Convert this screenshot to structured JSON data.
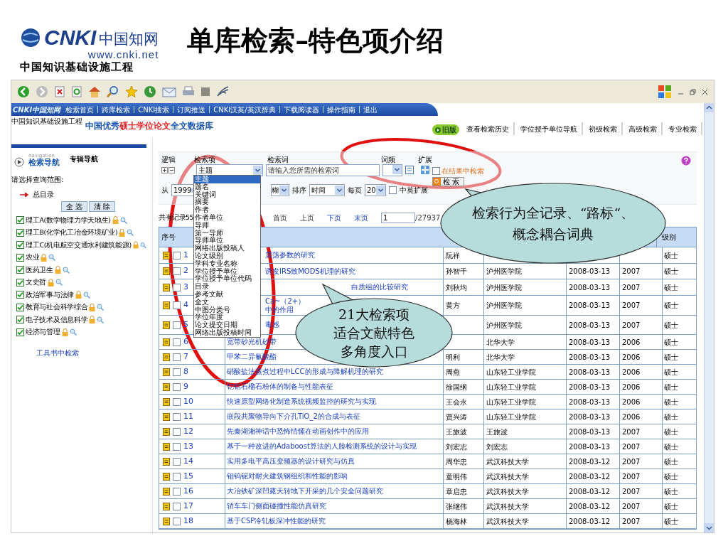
{
  "slide": {
    "title": "单库检索–特色项介绍",
    "logo": {
      "mark": "CNKI",
      "name": "中国知网",
      "url": "www.cnki.net",
      "tagline": "中国知识基础设施工程"
    }
  },
  "site": {
    "logo": "CNKI中国知网",
    "tagline": "中国知识基础设施工程",
    "nav": [
      "检索首页",
      "跨库检索",
      "CNKI搜索",
      "订阅推送",
      "CNKI汉英/英汉辞典",
      "下载阅读器",
      "操作指南",
      "退出"
    ],
    "database": {
      "prefix": "中国优秀",
      "highlight": "硕士学位论文",
      "suffix": "全文数据库"
    },
    "tabs": [
      {
        "label": "旧版",
        "kind": "badge",
        "selected": false
      },
      {
        "label": "查看检索历史",
        "kind": "tab",
        "selected": false
      },
      {
        "label": "学位授予单位导航",
        "kind": "tab",
        "selected": false
      },
      {
        "label": "初级检索",
        "kind": "tab",
        "selected": false
      },
      {
        "label": "高级检索",
        "kind": "tab",
        "selected": false
      },
      {
        "label": "专业检索",
        "kind": "tab",
        "selected": false
      }
    ]
  },
  "sidebar": {
    "nav_caption": "navigation",
    "nav_title": "检索导航",
    "alt_title": "专辑导航",
    "scope_label": "请选择查询范围:",
    "root": "总目录",
    "buttons": [
      "全 选",
      "清 除"
    ],
    "categories": [
      {
        "label": "理工A(数学物理力学天地生)",
        "checked": true
      },
      {
        "label": "理工B(化学化工冶金环境矿业)",
        "checked": true
      },
      {
        "label": "理工C(机电航空交通水利建筑能源)",
        "checked": true
      },
      {
        "label": "农业",
        "checked": true
      },
      {
        "label": "医药卫生",
        "checked": true
      },
      {
        "label": "文史哲",
        "checked": true
      },
      {
        "label": "政治军事与法律",
        "checked": true
      },
      {
        "label": "教育与社会科学综合",
        "checked": true
      },
      {
        "label": "电子技术及信息科学",
        "checked": true
      },
      {
        "label": "经济与管理",
        "checked": true
      }
    ],
    "link": "工具书中检索"
  },
  "search": {
    "headers": [
      "逻辑",
      "检索项",
      "检索词",
      "词频",
      "扩展"
    ],
    "field": "主题",
    "placeholder": "请输入您所需的检索词",
    "in_results": {
      "label": "在结果中检索",
      "checked": false
    },
    "button": "检 索",
    "from_label": "从",
    "from_value": "1999",
    "match_value": "糊",
    "sort_label": "排序",
    "sort_value": "时间",
    "per_page_label": "每页",
    "per_page_value": "20",
    "expand": {
      "label": "中英扩展",
      "checked": false
    }
  },
  "dropdown": {
    "options": [
      {
        "label": "主题",
        "selected": true
      },
      {
        "label": "题名",
        "selected": false
      },
      {
        "label": "关键词",
        "selected": false
      },
      {
        "label": "摘要",
        "selected": false
      },
      {
        "label": "作者",
        "selected": false
      },
      {
        "label": "作者单位",
        "selected": false
      },
      {
        "label": "导师",
        "selected": false
      },
      {
        "label": "第一导师",
        "selected": false
      },
      {
        "label": "导师单位",
        "selected": false
      },
      {
        "label": "网络出版投稿人",
        "selected": false
      },
      {
        "label": "论文级别",
        "selected": false
      },
      {
        "label": "学科专业名称",
        "selected": false
      },
      {
        "label": "学位授予单位",
        "selected": false
      },
      {
        "label": "学位授予单位代码",
        "selected": false
      },
      {
        "label": "目录",
        "selected": false
      },
      {
        "label": "参考文献",
        "selected": false
      },
      {
        "label": "全文",
        "selected": false
      },
      {
        "label": "中图分类号",
        "selected": false
      },
      {
        "label": "学位年度",
        "selected": false
      },
      {
        "label": "论文提交日期",
        "selected": false
      },
      {
        "label": "网络出版投稿时间",
        "selected": false
      }
    ]
  },
  "pager": {
    "count": "共有记录55",
    "links": [
      "首页",
      "上页",
      "下页",
      "末页"
    ],
    "page": "1",
    "total": "/27937"
  },
  "table": {
    "columns": [
      "序号",
      "级别"
    ],
    "rows": [
      {
        "no": "1",
        "checked": false,
        "title": "震荡参数的研究",
        "author": "阮祥",
        "level": "硕士"
      },
      {
        "no": "2",
        "checked": false,
        "title": "诱发IRS致MODS机理的研究",
        "author": "孙智千",
        "unit": "泸州医学院",
        "date": "2008-03-13",
        "year": "2007",
        "level": "硕士"
      },
      {
        "no": "3",
        "checked": false,
        "title": "白质组的比较研究",
        "author": "刘秋均",
        "unit": "泸州医学院",
        "date": "2008-03-13",
        "year": "2007",
        "level": "硕士"
      },
      {
        "no": "4",
        "checked": false,
        "title": "Ca~（2+）中的作用",
        "author": "黄方",
        "unit": "泸州医学院",
        "date": "2008-03-13",
        "year": "2007",
        "level": "硕士"
      },
      {
        "no": "5",
        "checked": false,
        "title": "毒感",
        "unit": "泸州医学院",
        "date": "2008-03-13",
        "year": "2007",
        "level": "硕士"
      },
      {
        "no": "6",
        "checked": false,
        "title": "宽带砂光机砂带",
        "unit": "北华大学",
        "date": "2008-03-13",
        "year": "2006",
        "level": "硕士"
      },
      {
        "no": "7",
        "checked": false,
        "title": "甲苯二异氰酸酯",
        "author": "明利",
        "unit": "北华大学",
        "date": "2008-03-13",
        "year": "2006",
        "level": "硕士"
      },
      {
        "no": "8",
        "checked": false,
        "title": "硝酸盐法蒸煮过程中LCC的形成与降解机理的研究",
        "author": "周燕",
        "unit": "山东轻工业学院",
        "date": "2008-03-13",
        "year": "2006",
        "level": "硕士"
      },
      {
        "no": "9",
        "checked": false,
        "title": "钇铝石榴石粉体的制备与性能表征",
        "author": "徐国纲",
        "unit": "山东轻工业学院",
        "date": "2008-03-13",
        "year": "2006",
        "level": "硕士"
      },
      {
        "no": "10",
        "checked": false,
        "title": "快速原型网络化制造系统视频监控的研究与实现",
        "author": "王会永",
        "unit": "山东轻工业学院",
        "date": "2008-03-13",
        "year": "2006",
        "level": "硕士"
      },
      {
        "no": "11",
        "checked": false,
        "title": "嵌段共聚物导向下介孔TiO_2的合成与表征",
        "author": "贾兴涛",
        "unit": "山东轻工业学院",
        "date": "2008-03-13",
        "year": "2006",
        "level": "硕士"
      },
      {
        "no": "12",
        "checked": false,
        "title": "先秦湖湘神话中恐怖情愫在动画创作中的应用",
        "author": "王旅波",
        "unit": "王旅波",
        "date": "2008-03-13",
        "year": "2007",
        "level": "硕士"
      },
      {
        "no": "13",
        "checked": false,
        "title": "基于一种改进的Adaboost算法的人脸检测系统的设计与实现",
        "author": "刘宏志",
        "unit": "刘宏志",
        "date": "2008-03-13",
        "year": "2007",
        "level": "硕士"
      },
      {
        "no": "14",
        "checked": false,
        "title": "实用多电平高压变频器的设计研究与仿真",
        "author": "周华忠",
        "unit": "武汉科技大学",
        "date": "2008-03-12",
        "year": "2007",
        "level": "硕士"
      },
      {
        "no": "15",
        "checked": false,
        "title": "钼钨铌对耐火建筑钢组织和性能的影响",
        "author": "童明伟",
        "unit": "武汉科技大学",
        "date": "2008-03-12",
        "year": "2007",
        "level": "硕士"
      },
      {
        "no": "16",
        "checked": false,
        "title": "大冶铁矿深凹露天转地下开采的几个安全问题研究",
        "author": "章启忠",
        "unit": "武汉科技大学",
        "date": "2008-03-12",
        "year": "2007",
        "level": "硕士"
      },
      {
        "no": "17",
        "checked": false,
        "title": "轿车车门侧面碰撞性能仿真研究",
        "author": "张继伟",
        "unit": "武汉科技大学",
        "date": "2008-03-12",
        "year": "2007",
        "level": "硕士"
      },
      {
        "no": "18",
        "checked": false,
        "title": "基于CSP冷轧板深冲性能的研究",
        "author": "杨海林",
        "unit": "武汉科技大学",
        "date": "2008-03-12",
        "year": "2007",
        "level": "硕士"
      }
    ]
  },
  "callouts": [
    {
      "lines": [
        "检索行为全记录、“路标“、",
        "概念耦合词典"
      ]
    },
    {
      "lines": [
        "21大检索项",
        "适合文献特色",
        "多角度入口"
      ]
    }
  ]
}
